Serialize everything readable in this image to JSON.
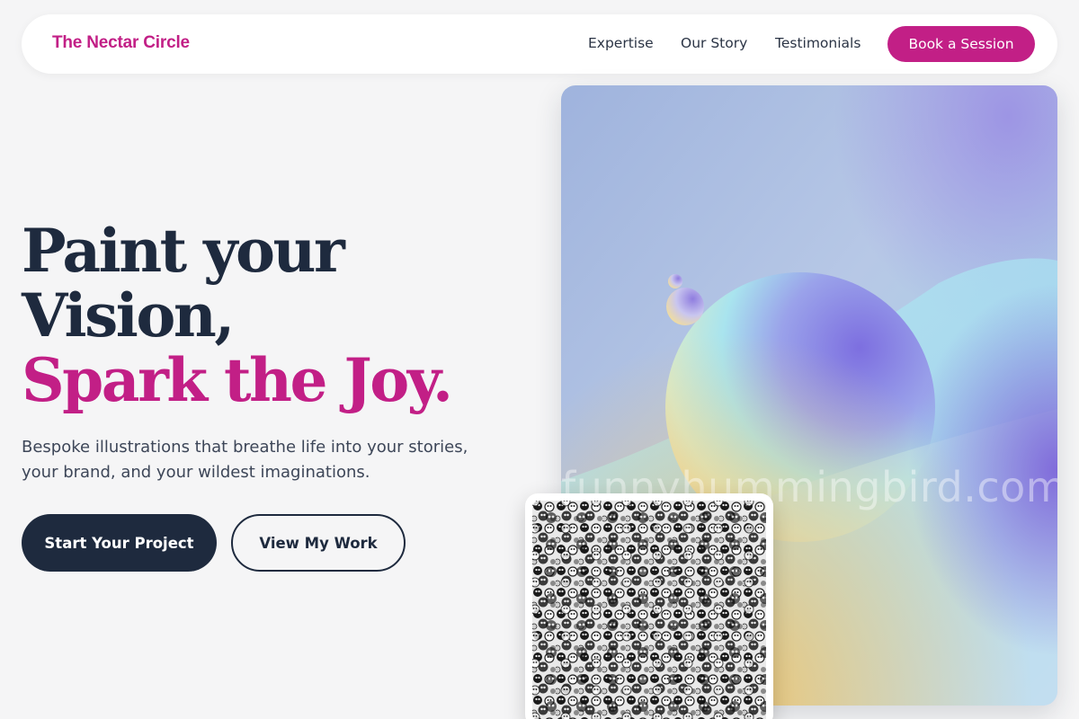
{
  "nav": {
    "brand": "The Nectar Circle",
    "links": [
      "Expertise",
      "Our Story",
      "Testimonials"
    ],
    "cta": "Book a Session"
  },
  "hero": {
    "headline_line1": "Paint your",
    "headline_line2": "Vision,",
    "headline_accent": "Spark the Joy.",
    "subtitle": "Bespoke illustrations that breathe life into your stories, your brand, and your wildest imaginations.",
    "primary_button": "Start Your Project",
    "secondary_button": "View My Work"
  },
  "image": {
    "watermark": "funnyhummingbird.com"
  },
  "colors": {
    "accent": "#c21f86",
    "dark": "#1e2a3e",
    "background": "#f5f5f6"
  }
}
